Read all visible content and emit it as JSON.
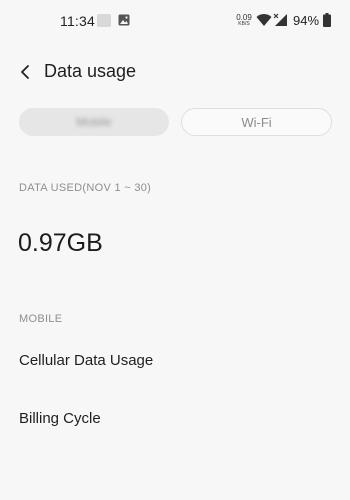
{
  "status_bar": {
    "time": "11:34",
    "speed_value": "0.09",
    "speed_unit": "KB/S",
    "battery_percent": "94%",
    "icons": [
      "image-icon",
      "wifi-icon",
      "signal-icon",
      "battery-icon"
    ]
  },
  "header": {
    "title": "Data usage",
    "back_icon": "chevron-left-icon"
  },
  "segments": {
    "mobile_label": "Mobile",
    "wifi_label": "Wi-Fi",
    "selected": "mobile"
  },
  "data_used": {
    "label": "DATA USED(NOV 1 ~ 30)",
    "value": "0.97GB"
  },
  "mobile_section": {
    "label": "MOBILE",
    "items": [
      {
        "label": "Cellular Data Usage"
      },
      {
        "label": "Billing Cycle"
      }
    ]
  },
  "colors": {
    "background": "#f7f7f7",
    "selected_segment": "#e6e6e6",
    "secondary_text": "#8f8f8f",
    "primary_text": "#1f1f1f"
  }
}
